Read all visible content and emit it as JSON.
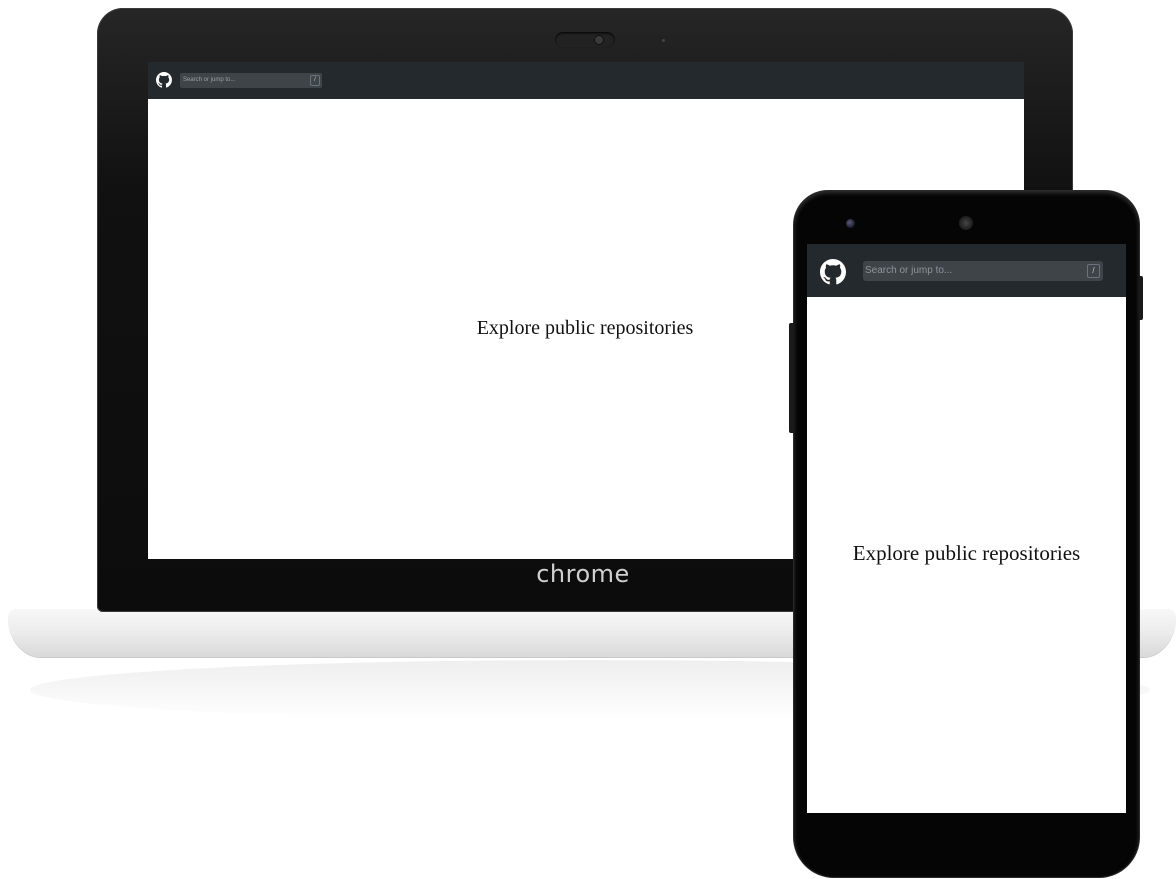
{
  "laptop": {
    "brand": "chrome",
    "screen": {
      "search_placeholder": "Search or jump to...",
      "search_shortcut": "/",
      "hero_text": "Explore public repositories"
    }
  },
  "phone": {
    "screen": {
      "search_placeholder": "Search or jump to...",
      "search_shortcut": "/",
      "hero_text": "Explore public repositories"
    }
  },
  "icons": {
    "logo": "github-octocat-icon"
  },
  "colors": {
    "nav_background": "#24292e",
    "search_background": "#3f4448",
    "page_background": "#ffffff"
  }
}
